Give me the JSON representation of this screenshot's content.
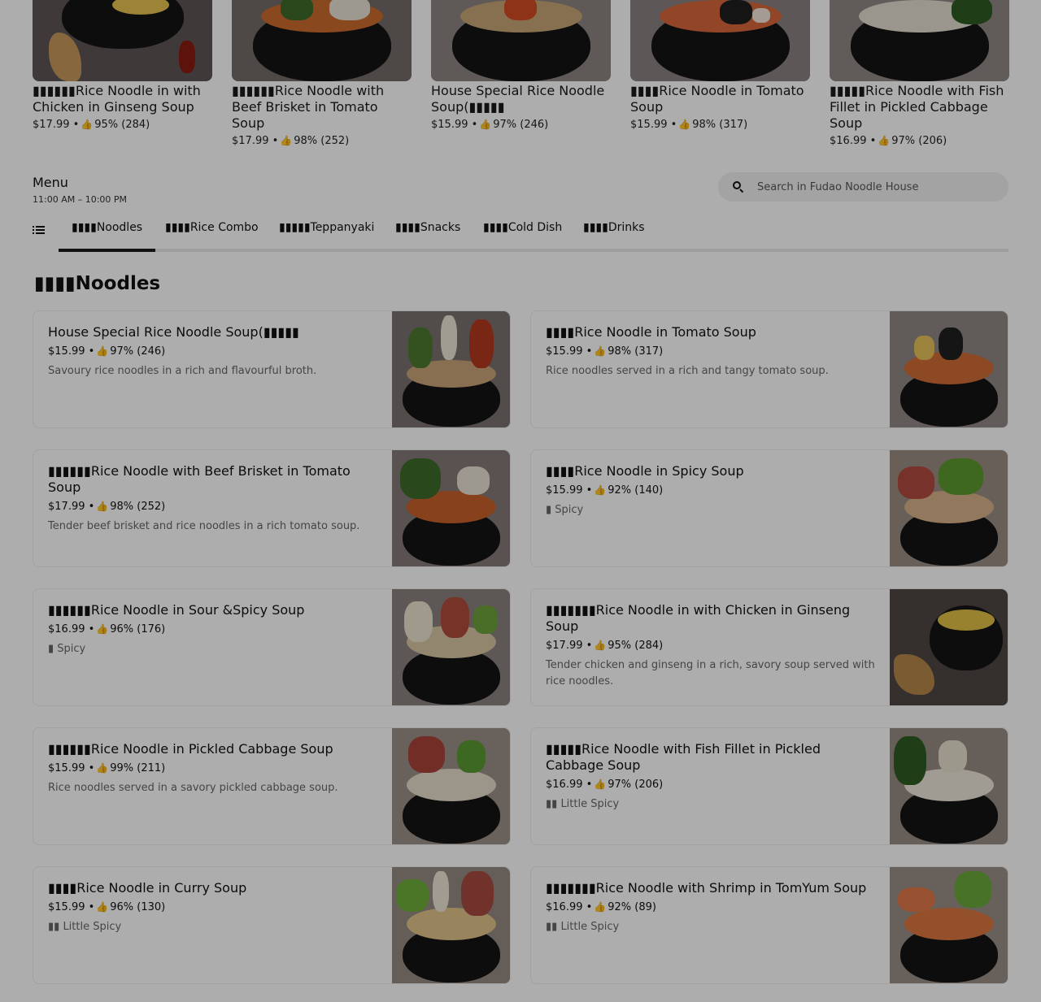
{
  "featured": [
    {
      "title": "▮▮▮▮▮▮Rice Noodle in with Chicken in Ginseng Soup",
      "price": "$17.99",
      "rating": "95% (284)"
    },
    {
      "title": "▮▮▮▮▮▮Rice Noodle with Beef Brisket in Tomato Soup",
      "price": "$17.99",
      "rating": "98% (252)"
    },
    {
      "title": "House Special Rice Noodle Soup(▮▮▮▮▮",
      "price": "$15.99",
      "rating": "97% (246)"
    },
    {
      "title": "▮▮▮▮Rice Noodle in Tomato Soup",
      "price": "$15.99",
      "rating": "98% (317)"
    },
    {
      "title": "▮▮▮▮▮Rice Noodle with Fish Fillet in Pickled Cabbage Soup",
      "price": "$16.99",
      "rating": "97% (206)"
    }
  ],
  "menu": {
    "title": "Menu",
    "hours": "11:00 AM – 10:00 PM"
  },
  "search": {
    "placeholder": "Search in Fudao Noodle House"
  },
  "tabs": [
    {
      "label": "▮▮▮▮Noodles"
    },
    {
      "label": "▮▮▮▮Rice Combo"
    },
    {
      "label": "▮▮▮▮▮Teppanyaki"
    },
    {
      "label": "▮▮▮▮Snacks"
    },
    {
      "label": "▮▮▮▮Cold Dish"
    },
    {
      "label": "▮▮▮▮Drinks"
    }
  ],
  "section": {
    "title": "▮▮▮▮Noodles"
  },
  "items": [
    {
      "title": "House Special Rice Noodle Soup(▮▮▮▮▮",
      "price": "$15.99",
      "rating": "97% (246)",
      "desc": "Savoury rice noodles in a rich and flavourful broth."
    },
    {
      "title": "▮▮▮▮Rice Noodle in Tomato Soup",
      "price": "$15.99",
      "rating": "98% (317)",
      "desc": "Rice noodles served in a rich and tangy tomato soup."
    },
    {
      "title": "▮▮▮▮▮▮Rice Noodle with Beef Brisket in Tomato Soup",
      "price": "$17.99",
      "rating": "98% (252)",
      "desc": "Tender beef brisket and rice noodles in a rich tomato soup."
    },
    {
      "title": "▮▮▮▮Rice Noodle in Spicy Soup",
      "price": "$15.99",
      "rating": "92% (140)",
      "desc": "▮ Spicy"
    },
    {
      "title": "▮▮▮▮▮▮Rice Noodle in Sour &Spicy Soup",
      "price": "$16.99",
      "rating": "96% (176)",
      "desc": "▮ Spicy"
    },
    {
      "title": "▮▮▮▮▮▮▮Rice Noodle in with Chicken in Ginseng Soup",
      "price": "$17.99",
      "rating": "95% (284)",
      "desc": "Tender chicken and ginseng in a rich, savory soup served with rice noodles."
    },
    {
      "title": "▮▮▮▮▮▮Rice Noodle in Pickled Cabbage Soup",
      "price": "$15.99",
      "rating": "99% (211)",
      "desc": "Rice noodles served in a savory pickled cabbage soup."
    },
    {
      "title": "▮▮▮▮▮Rice Noodle with Fish Fillet in Pickled Cabbage Soup",
      "price": "$16.99",
      "rating": "97% (206)",
      "desc": "▮▮ Little Spicy"
    },
    {
      "title": "▮▮▮▮Rice Noodle in Curry Soup",
      "price": "$15.99",
      "rating": "96% (130)",
      "desc": "▮▮ Little Spicy"
    },
    {
      "title": "▮▮▮▮▮▮▮Rice Noodle with Shrimp in TomYum Soup",
      "price": "$16.99",
      "rating": "92% (89)",
      "desc": "▮▮ Little Spicy"
    }
  ],
  "icons": {
    "search": "search-icon",
    "menu_list": "list-icon",
    "rating": "thumbs-up-icon"
  }
}
